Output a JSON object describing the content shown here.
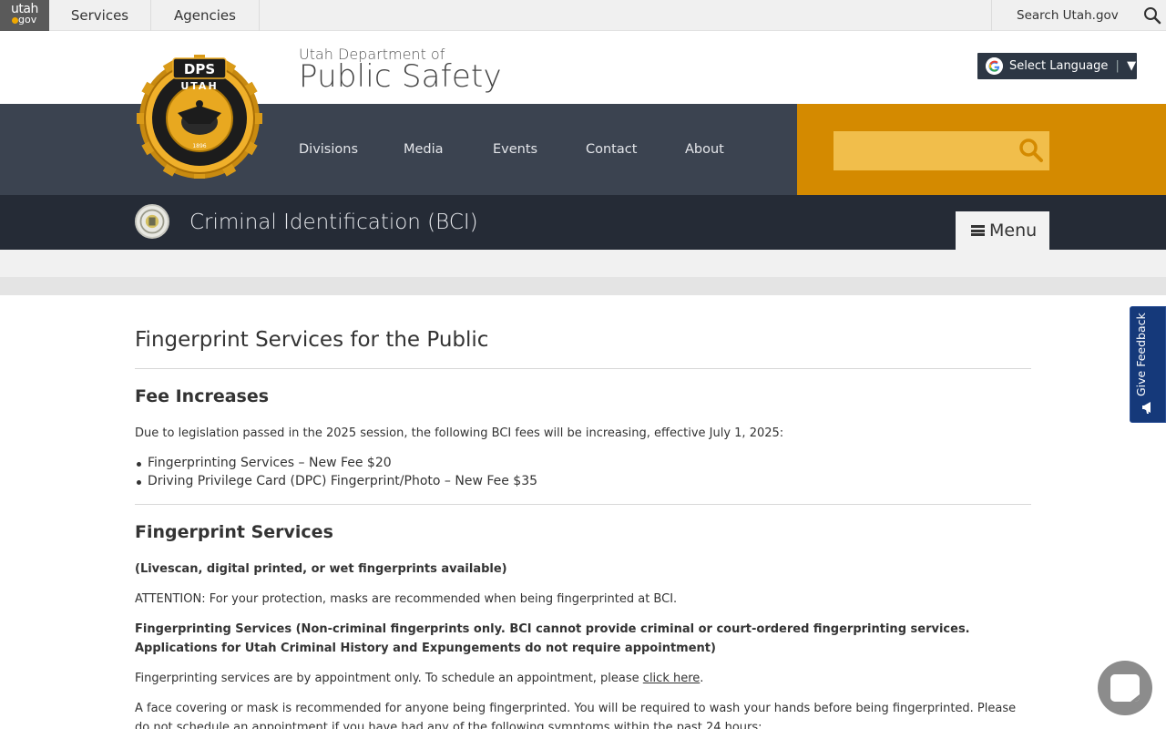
{
  "topbar": {
    "logo_line1": "utah",
    "logo_line2": "gov",
    "nav": [
      "Services",
      "Agencies"
    ],
    "search_label": "Search Utah.gov"
  },
  "header": {
    "agency_pre": "Utah Department of",
    "agency_name": "Public Safety",
    "seal_top_text": "DPS",
    "seal_ring_text": "UTAH",
    "seal_year": "1896",
    "language_button": "Select Language",
    "language_caret": "▼"
  },
  "mainnav": {
    "items": [
      "Divisions",
      "Media",
      "Events",
      "Contact",
      "About"
    ],
    "search_placeholder": ""
  },
  "division": {
    "title": "Criminal Identification (BCI)",
    "menu_label": "Menu"
  },
  "content": {
    "page_title": "Fingerprint Services for the Public",
    "fee_heading": "Fee Increases",
    "fee_intro": "Due to legislation passed in the 2025 session, the following BCI fees will be increasing, effective July 1, 2025:",
    "fee_items": [
      "Fingerprinting Services – New Fee $20",
      "Driving Privilege Card (DPC) Fingerprint/Photo – New Fee $35"
    ],
    "services_heading": "Fingerprint Services",
    "availability": "(Livescan, digital printed, or wet fingerprints available)",
    "attention": "ATTENTION: For your protection, masks are recommended when being fingerprinted at BCI.",
    "services_note": "Fingerprinting Services (Non-criminal fingerprints only. BCI cannot provide criminal or court-ordered fingerprinting services. Applications for Utah Criminal History and Expungements do not require appointment)",
    "appointment_text": "Fingerprinting services are by appointment only.  To schedule an appointment, please ",
    "appointment_link": "click here",
    "appointment_end": ".",
    "mask_text": "A face covering or mask is recommended for anyone being fingerprinted.  You will be required to wash your hands before being fingerprinted.  Please do not schedule an appointment if you have had any of the following symptoms within the past 24 hours:"
  },
  "feedback": {
    "label": "Give Feedback"
  },
  "colors": {
    "nav_bg": "#3b4350",
    "division_bar_bg": "#252b36",
    "search_zone": "#d48a00",
    "feedback_tab": "#15397a"
  }
}
